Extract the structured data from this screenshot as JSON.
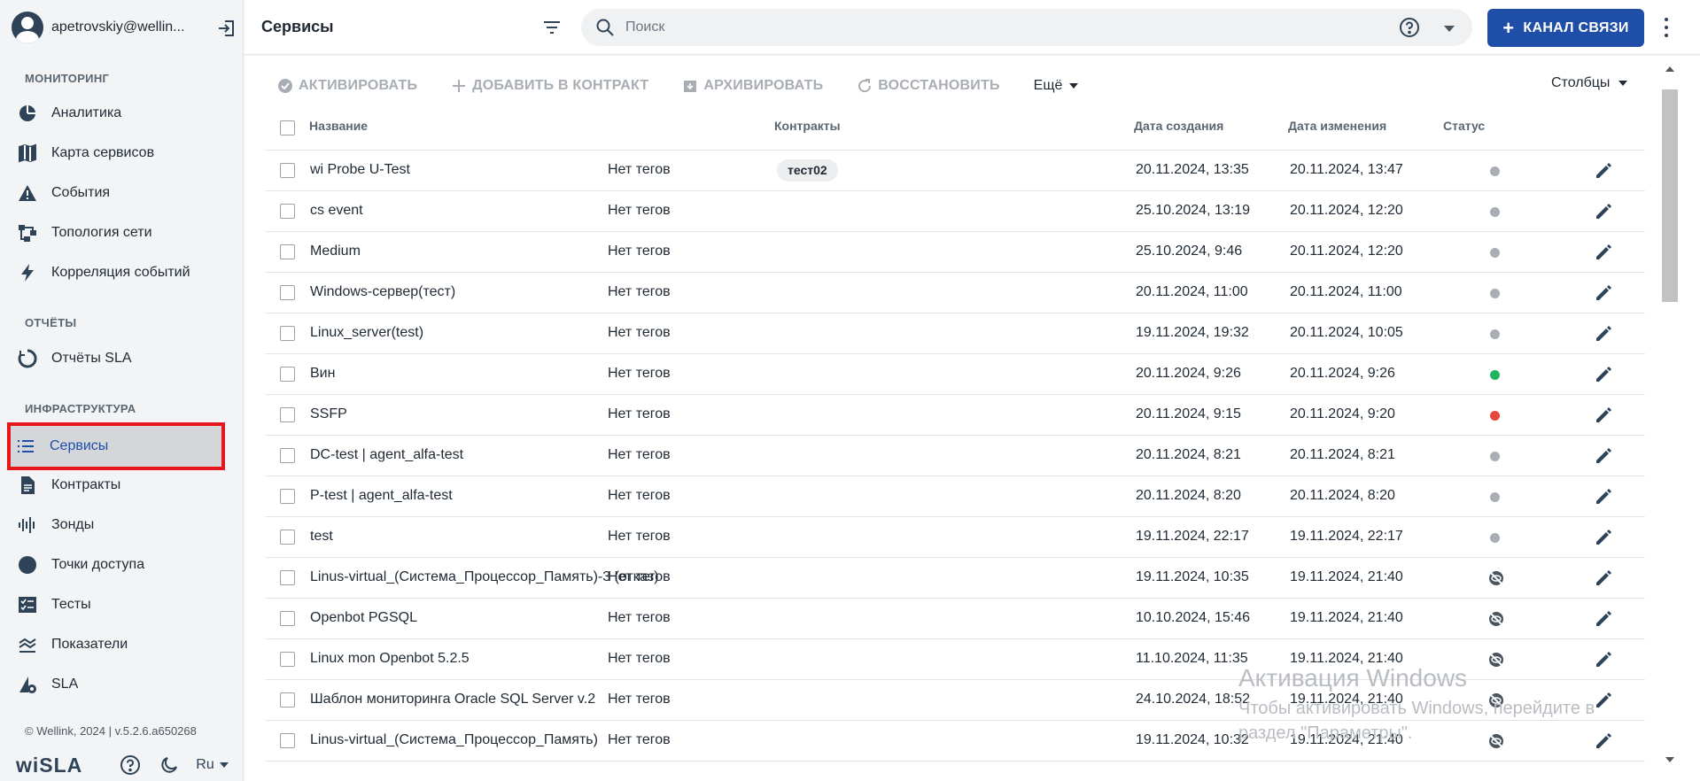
{
  "user": {
    "email": "apetrovskiy@wellin..."
  },
  "sidebar": {
    "sections": [
      {
        "title": "МОНИТОРИНГ"
      },
      {
        "title": "ОТЧЁТЫ"
      },
      {
        "title": "ИНФРАСТРУКТУРА"
      }
    ],
    "items": [
      {
        "label": "Аналитика",
        "icon": "pie-chart-icon"
      },
      {
        "label": "Карта сервисов",
        "icon": "map-icon"
      },
      {
        "label": "События",
        "icon": "warning-icon"
      },
      {
        "label": "Топология сети",
        "icon": "topology-icon"
      },
      {
        "label": "Корреляция событий",
        "icon": "lightning-icon"
      },
      {
        "label": "Отчёты SLA",
        "icon": "refresh-circle-icon"
      },
      {
        "label": "Сервисы",
        "icon": "list-icon",
        "active": true
      },
      {
        "label": "Контракты",
        "icon": "document-icon"
      },
      {
        "label": "Зонды",
        "icon": "probe-icon"
      },
      {
        "label": "Точки доступа",
        "icon": "circle-icon"
      },
      {
        "label": "Тесты",
        "icon": "checklist-icon"
      },
      {
        "label": "Показатели",
        "icon": "metrics-icon"
      },
      {
        "label": "SLA",
        "icon": "sla-icon"
      }
    ],
    "copyright": "© Wellink, 2024 | v.5.2.6.a650268",
    "logo": "wiSLA",
    "language": "Ru"
  },
  "header": {
    "title": "Сервисы",
    "search_placeholder": "Поиск",
    "channel_button": "КАНАЛ СВЯЗИ"
  },
  "toolbar": {
    "activate": "АКТИВИРОВАТЬ",
    "add_to_contract": "ДОБАВИТЬ В КОНТРАКТ",
    "archive": "АРХИВИРОВАТЬ",
    "restore": "ВОССТАНОВИТЬ",
    "more": "Ещё",
    "columns": "Столбцы"
  },
  "table": {
    "columns": {
      "name": "Название",
      "contracts": "Контракты",
      "created": "Дата создания",
      "modified": "Дата изменения",
      "status": "Статус"
    },
    "rows": [
      {
        "name": "wi Probe U-Test",
        "tags": "Нет тегов",
        "contract": "тест02",
        "created": "20.11.2024, 13:35",
        "modified": "20.11.2024, 13:47",
        "status": "grey"
      },
      {
        "name": "cs event",
        "tags": "Нет тегов",
        "contract": "",
        "created": "25.10.2024, 13:19",
        "modified": "20.11.2024, 12:20",
        "status": "grey"
      },
      {
        "name": "Medium",
        "tags": "Нет тегов",
        "contract": "",
        "created": "25.10.2024, 9:46",
        "modified": "20.11.2024, 12:20",
        "status": "grey"
      },
      {
        "name": "Windows-сервер(тест)",
        "tags": "Нет тегов",
        "contract": "",
        "created": "20.11.2024, 11:00",
        "modified": "20.11.2024, 11:00",
        "status": "grey"
      },
      {
        "name": "Linux_server(test)",
        "tags": "Нет тегов",
        "contract": "",
        "created": "19.11.2024, 19:32",
        "modified": "20.11.2024, 10:05",
        "status": "grey"
      },
      {
        "name": "Вин",
        "tags": "Нет тегов",
        "contract": "",
        "created": "20.11.2024, 9:26",
        "modified": "20.11.2024, 9:26",
        "status": "green"
      },
      {
        "name": "SSFP",
        "tags": "Нет тегов",
        "contract": "",
        "created": "20.11.2024, 9:15",
        "modified": "20.11.2024, 9:20",
        "status": "red"
      },
      {
        "name": "DC-test | agent_alfa-test",
        "tags": "Нет тегов",
        "contract": "",
        "created": "20.11.2024, 8:21",
        "modified": "20.11.2024, 8:21",
        "status": "grey"
      },
      {
        "name": "P-test | agent_alfa-test",
        "tags": "Нет тегов",
        "contract": "",
        "created": "20.11.2024, 8:20",
        "modified": "20.11.2024, 8:20",
        "status": "grey"
      },
      {
        "name": "test",
        "tags": "Нет тегов",
        "contract": "",
        "created": "19.11.2024, 22:17",
        "modified": "19.11.2024, 22:17",
        "status": "grey"
      },
      {
        "name": "Linus-virtual_(Система_Процессор_Память)-3 (отказ)",
        "tags": "Нет тегов",
        "contract": "",
        "created": "19.11.2024, 10:35",
        "modified": "19.11.2024, 21:40",
        "status": "off"
      },
      {
        "name": "Openbot PGSQL",
        "tags": "Нет тегов",
        "contract": "",
        "created": "10.10.2024, 15:46",
        "modified": "19.11.2024, 21:40",
        "status": "off"
      },
      {
        "name": "Linux mon Openbot 5.2.5",
        "tags": "Нет тегов",
        "contract": "",
        "created": "11.10.2024, 11:35",
        "modified": "19.11.2024, 21:40",
        "status": "off"
      },
      {
        "name": "Шаблон мониторинга Oracle SQL Server v.2",
        "tags": "Нет тегов",
        "contract": "",
        "created": "24.10.2024, 18:52",
        "modified": "19.11.2024, 21:40",
        "status": "off"
      },
      {
        "name": "Linus-virtual_(Система_Процессор_Память)",
        "tags": "Нет тегов",
        "contract": "",
        "created": "19.11.2024, 10:32",
        "modified": "19.11.2024, 21:40",
        "status": "off"
      }
    ]
  },
  "status_colors": {
    "grey": "#a9aeb4",
    "green": "#22b35e",
    "red": "#e8453c"
  },
  "watermark": {
    "title": "Активация Windows",
    "subtitle": "Чтобы активировать Windows, перейдите в раздел \"Параметры\"."
  }
}
